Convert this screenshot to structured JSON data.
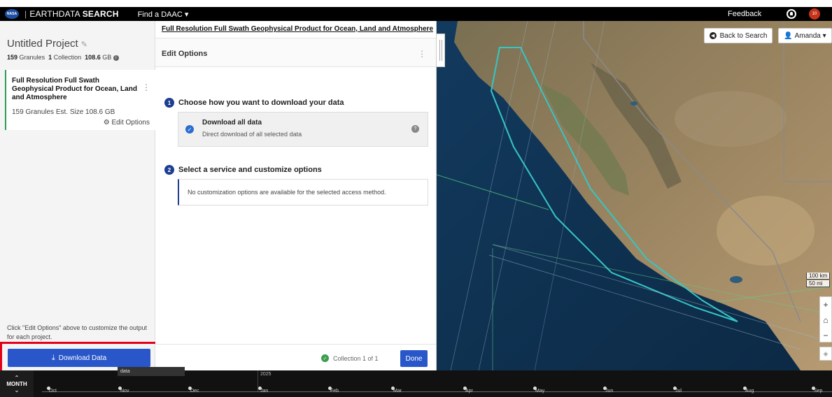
{
  "header": {
    "brand_main": "EARTHDATA",
    "brand_bold": "SEARCH",
    "find_daac": "Find a DAAC",
    "feedback": "Feedback",
    "badge": "10"
  },
  "sidebar": {
    "project_title": "Untitled Project",
    "granules_count": "159",
    "granules_label": "Granules",
    "collections_count": "1",
    "collections_label": "Collection",
    "size": "108.6",
    "size_unit": "GB",
    "collection_title": "Full Resolution Full Swath Geophysical Product for Ocean, Land and Atmosphere",
    "collection_meta": "159 Granules  Est. Size 108.6 GB",
    "edit_options": "Edit Options",
    "hint": "Click \"Edit Options\" above to customize the output for each project.",
    "download_button": "Download Data",
    "tooltip": "data"
  },
  "panel": {
    "title": "Full Resolution Full Swath Geophysical Product for Ocean, Land and Atmosphere",
    "subheader": "Edit Options",
    "step1_num": "1",
    "step1_label": "Choose how you want to download your data",
    "option_title": "Download all data",
    "option_desc": "Direct download of all selected data",
    "step2_num": "2",
    "step2_label": "Select a service and customize options",
    "notice": "No customization options are available for the selected access method.",
    "footer_status": "Collection 1 of 1",
    "done_button": "Done"
  },
  "map": {
    "back_button": "Back to Search",
    "user_button": "Amanda",
    "scale_km": "100 km",
    "scale_mi": "50 mi",
    "zoom_in": "+",
    "home": "⌂",
    "zoom_out": "−"
  },
  "timeline": {
    "interval": "MONTH",
    "year": "2025",
    "months": [
      "Oct",
      "Nov",
      "Dec",
      "Jan",
      "Feb",
      "Mar",
      "Apr",
      "May",
      "Jun",
      "Jul",
      "Aug",
      "Sep"
    ]
  }
}
